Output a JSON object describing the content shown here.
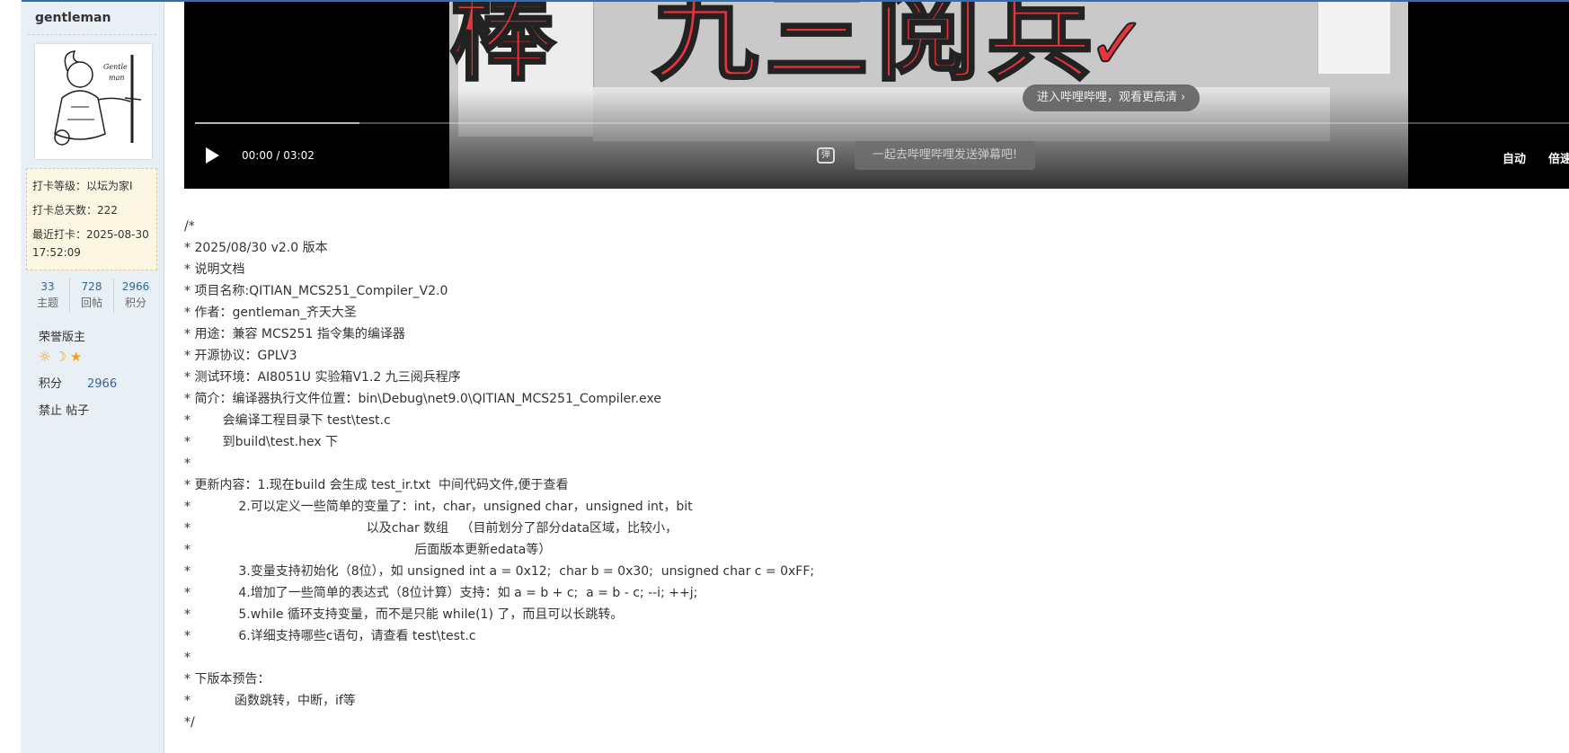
{
  "user": {
    "name": "gentleman",
    "checkin_level": "打卡等级：以坛为家I",
    "checkin_days": "打卡总天数：222",
    "last_checkin": "最近打卡：2025-08-30 17:52:09",
    "stats": [
      {
        "num": "33",
        "label": "主题"
      },
      {
        "num": "728",
        "label": "回帖"
      },
      {
        "num": "2966",
        "label": "积分"
      }
    ],
    "honor": "荣誉版主",
    "score_label": "积分",
    "score_value": "2966",
    "ban": "禁止 帖子"
  },
  "video": {
    "overlay_title": "棒  九三阅兵",
    "enter_bilibili": "进入哔哩哔哩，观看更高清 ›",
    "time": "00:00 / 03:02",
    "progress": 0.12,
    "danmu_icon": "弹",
    "danmu_placeholder": "一起去哔哩哔哩发送弹幕吧!",
    "auto": "自动",
    "speed": "倍速"
  },
  "post": {
    "lines": [
      "/*",
      "* 2025/08/30 v2.0 版本",
      "* 说明文档",
      "* 项目名称:QITIAN_MCS251_Compiler_V2.0",
      "* 作者：gentleman_齐天大圣",
      "* 用途：兼容 MCS251 指令集的编译器",
      "* 开源协议：GPLV3",
      "* 测试环境：AI8051U 实验箱V1.2 九三阅兵程序",
      "* 简介：编译器执行文件位置：bin\\Debug\\net9.0\\QITIAN_MCS251_Compiler.exe",
      "*        会编译工程目录下 test\\test.c",
      "*        到build\\test.hex 下",
      "*",
      "* 更新内容：1.现在build 会生成 test_ir.txt  中间代码文件,便于查看",
      "*            2.可以定义一些简单的变量了：int，char，unsigned char，unsigned int，bit",
      "*                                            以及char 数组   （目前划分了部分data区域，比较小，",
      "*                                                        后面版本更新edata等）",
      "*            3.变量支持初始化（8位），如 unsigned int a = 0x12;  char b = 0x30;  unsigned char c = 0xFF;",
      "*            4.增加了一些简单的表达式（8位计算）支持：如 a = b + c;  a = b - c; --i; ++j;",
      "*            5.while 循环支持变量，而不是只能 while(1) 了，而且可以长跳转。",
      "*            6.详细支持哪些c语句，请查看 test\\test.c",
      "*",
      "* 下版本预告：",
      "*           函数跳转，中断，if等",
      "*/"
    ]
  },
  "colors": {
    "accent": "#2f6fb6",
    "sidebar_bg": "#e8eff5",
    "checkin_bg": "#fdf6e3",
    "link": "#336699",
    "medal": "#f0a020"
  }
}
